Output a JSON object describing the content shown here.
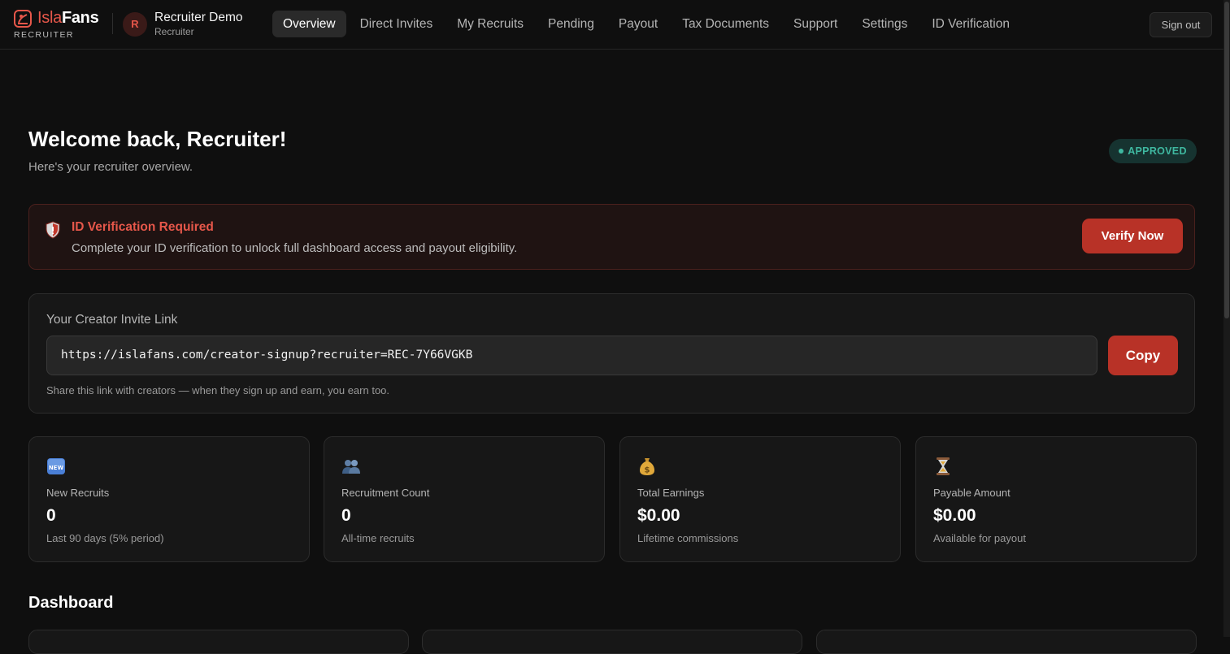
{
  "brand": {
    "name_part1": "Isla",
    "name_part2": "Fans",
    "subtitle": "RECRUITER",
    "accent_color": "#e6574a"
  },
  "user": {
    "initial": "R",
    "name": "Recruiter Demo",
    "role": "Recruiter"
  },
  "nav": {
    "tabs": [
      {
        "label": "Overview",
        "active": true
      },
      {
        "label": "Direct Invites",
        "active": false
      },
      {
        "label": "My Recruits",
        "active": false
      },
      {
        "label": "Pending",
        "active": false
      },
      {
        "label": "Payout",
        "active": false
      },
      {
        "label": "Tax Documents",
        "active": false
      },
      {
        "label": "Support",
        "active": false
      },
      {
        "label": "Settings",
        "active": false
      },
      {
        "label": "ID Verification",
        "active": false
      }
    ],
    "signout_label": "Sign out"
  },
  "header": {
    "title": "Welcome back, Recruiter!",
    "subtitle": "Here's your recruiter overview.",
    "status_badge": "APPROVED",
    "status_color": "#3fb8a0"
  },
  "alert": {
    "icon": "shield-icon",
    "title": "ID Verification Required",
    "text": "Complete your ID verification to unlock full dashboard access and payout eligibility.",
    "button_label": "Verify Now"
  },
  "invite": {
    "label": "Your Creator Invite Link",
    "link": "https://islafans.com/creator-signup?recruiter=REC-7Y66VGKB",
    "copy_label": "Copy",
    "help_text": "Share this link with creators — when they sign up and earn, you earn too."
  },
  "stats": [
    {
      "icon": "new-badge-icon",
      "label": "New Recruits",
      "value": "0",
      "description": "Last 90 days (5% period)"
    },
    {
      "icon": "people-icon",
      "label": "Recruitment Count",
      "value": "0",
      "description": "All-time recruits"
    },
    {
      "icon": "money-bag-icon",
      "label": "Total Earnings",
      "value": "$0.00",
      "description": "Lifetime commissions"
    },
    {
      "icon": "hourglass-icon",
      "label": "Payable Amount",
      "value": "$0.00",
      "description": "Available for payout"
    }
  ],
  "dashboard": {
    "title": "Dashboard"
  }
}
